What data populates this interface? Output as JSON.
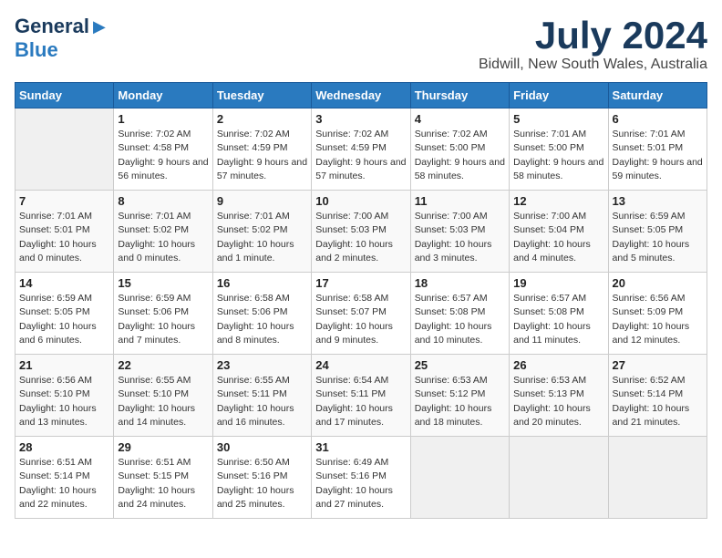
{
  "header": {
    "logo_general": "General",
    "logo_blue": "Blue",
    "month": "July 2024",
    "location": "Bidwill, New South Wales, Australia"
  },
  "days_of_week": [
    "Sunday",
    "Monday",
    "Tuesday",
    "Wednesday",
    "Thursday",
    "Friday",
    "Saturday"
  ],
  "weeks": [
    [
      {
        "day": "",
        "info": ""
      },
      {
        "day": "1",
        "info": "Sunrise: 7:02 AM\nSunset: 4:58 PM\nDaylight: 9 hours and 56 minutes."
      },
      {
        "day": "2",
        "info": "Sunrise: 7:02 AM\nSunset: 4:59 PM\nDaylight: 9 hours and 57 minutes."
      },
      {
        "day": "3",
        "info": "Sunrise: 7:02 AM\nSunset: 4:59 PM\nDaylight: 9 hours and 57 minutes."
      },
      {
        "day": "4",
        "info": "Sunrise: 7:02 AM\nSunset: 5:00 PM\nDaylight: 9 hours and 58 minutes."
      },
      {
        "day": "5",
        "info": "Sunrise: 7:01 AM\nSunset: 5:00 PM\nDaylight: 9 hours and 58 minutes."
      },
      {
        "day": "6",
        "info": "Sunrise: 7:01 AM\nSunset: 5:01 PM\nDaylight: 9 hours and 59 minutes."
      }
    ],
    [
      {
        "day": "7",
        "info": "Sunrise: 7:01 AM\nSunset: 5:01 PM\nDaylight: 10 hours and 0 minutes."
      },
      {
        "day": "8",
        "info": "Sunrise: 7:01 AM\nSunset: 5:02 PM\nDaylight: 10 hours and 0 minutes."
      },
      {
        "day": "9",
        "info": "Sunrise: 7:01 AM\nSunset: 5:02 PM\nDaylight: 10 hours and 1 minute."
      },
      {
        "day": "10",
        "info": "Sunrise: 7:00 AM\nSunset: 5:03 PM\nDaylight: 10 hours and 2 minutes."
      },
      {
        "day": "11",
        "info": "Sunrise: 7:00 AM\nSunset: 5:03 PM\nDaylight: 10 hours and 3 minutes."
      },
      {
        "day": "12",
        "info": "Sunrise: 7:00 AM\nSunset: 5:04 PM\nDaylight: 10 hours and 4 minutes."
      },
      {
        "day": "13",
        "info": "Sunrise: 6:59 AM\nSunset: 5:05 PM\nDaylight: 10 hours and 5 minutes."
      }
    ],
    [
      {
        "day": "14",
        "info": "Sunrise: 6:59 AM\nSunset: 5:05 PM\nDaylight: 10 hours and 6 minutes."
      },
      {
        "day": "15",
        "info": "Sunrise: 6:59 AM\nSunset: 5:06 PM\nDaylight: 10 hours and 7 minutes."
      },
      {
        "day": "16",
        "info": "Sunrise: 6:58 AM\nSunset: 5:06 PM\nDaylight: 10 hours and 8 minutes."
      },
      {
        "day": "17",
        "info": "Sunrise: 6:58 AM\nSunset: 5:07 PM\nDaylight: 10 hours and 9 minutes."
      },
      {
        "day": "18",
        "info": "Sunrise: 6:57 AM\nSunset: 5:08 PM\nDaylight: 10 hours and 10 minutes."
      },
      {
        "day": "19",
        "info": "Sunrise: 6:57 AM\nSunset: 5:08 PM\nDaylight: 10 hours and 11 minutes."
      },
      {
        "day": "20",
        "info": "Sunrise: 6:56 AM\nSunset: 5:09 PM\nDaylight: 10 hours and 12 minutes."
      }
    ],
    [
      {
        "day": "21",
        "info": "Sunrise: 6:56 AM\nSunset: 5:10 PM\nDaylight: 10 hours and 13 minutes."
      },
      {
        "day": "22",
        "info": "Sunrise: 6:55 AM\nSunset: 5:10 PM\nDaylight: 10 hours and 14 minutes."
      },
      {
        "day": "23",
        "info": "Sunrise: 6:55 AM\nSunset: 5:11 PM\nDaylight: 10 hours and 16 minutes."
      },
      {
        "day": "24",
        "info": "Sunrise: 6:54 AM\nSunset: 5:11 PM\nDaylight: 10 hours and 17 minutes."
      },
      {
        "day": "25",
        "info": "Sunrise: 6:53 AM\nSunset: 5:12 PM\nDaylight: 10 hours and 18 minutes."
      },
      {
        "day": "26",
        "info": "Sunrise: 6:53 AM\nSunset: 5:13 PM\nDaylight: 10 hours and 20 minutes."
      },
      {
        "day": "27",
        "info": "Sunrise: 6:52 AM\nSunset: 5:14 PM\nDaylight: 10 hours and 21 minutes."
      }
    ],
    [
      {
        "day": "28",
        "info": "Sunrise: 6:51 AM\nSunset: 5:14 PM\nDaylight: 10 hours and 22 minutes."
      },
      {
        "day": "29",
        "info": "Sunrise: 6:51 AM\nSunset: 5:15 PM\nDaylight: 10 hours and 24 minutes."
      },
      {
        "day": "30",
        "info": "Sunrise: 6:50 AM\nSunset: 5:16 PM\nDaylight: 10 hours and 25 minutes."
      },
      {
        "day": "31",
        "info": "Sunrise: 6:49 AM\nSunset: 5:16 PM\nDaylight: 10 hours and 27 minutes."
      },
      {
        "day": "",
        "info": ""
      },
      {
        "day": "",
        "info": ""
      },
      {
        "day": "",
        "info": ""
      }
    ]
  ]
}
